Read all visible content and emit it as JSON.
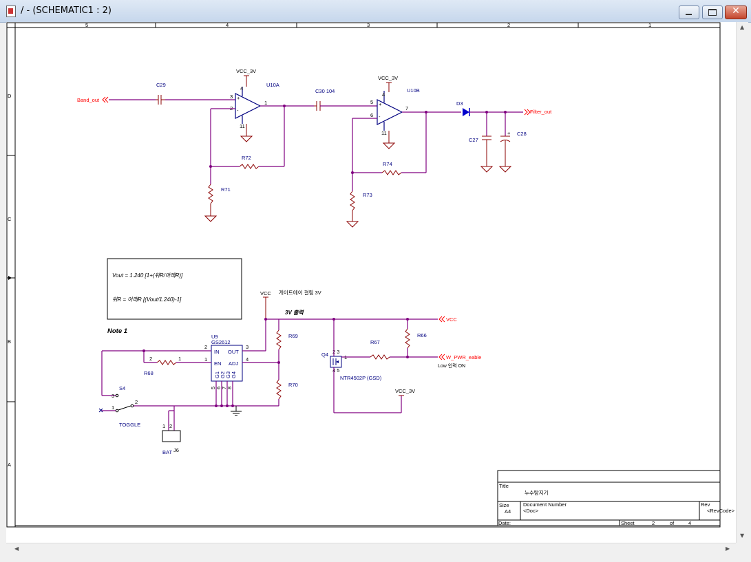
{
  "window": {
    "title": "/ - (SCHEMATIC1 : 2)"
  },
  "border": {
    "columns": [
      "5",
      "4",
      "3",
      "2",
      "1"
    ],
    "rows": [
      "D",
      "C",
      "B",
      "A"
    ]
  },
  "parts": {
    "C29": "C29",
    "U10A": "U10A",
    "C30": "C30  104",
    "U10B": "U10B",
    "D3": "D3",
    "C27": "C27",
    "C28": "C28",
    "R72": "R72",
    "R71": "R71",
    "R74": "R74",
    "R73": "R73",
    "U9": "U9",
    "U9_part": "GS2612",
    "R68": "R68",
    "R69": "R69",
    "R70": "R70",
    "R67": "R67",
    "R66": "R66",
    "Q4": "Q4",
    "Q4_part": "NTR4502P (GSD)",
    "S4": "S4",
    "S4_type": "TOGGLE",
    "J6": "J6",
    "J6_name": "BAT"
  },
  "pins": {
    "u10a_3": "3",
    "u10a_2": "2",
    "u10a_1": "1",
    "u10a_4": "4",
    "u10a_11": "11",
    "u10b_5": "5",
    "u10b_6": "6",
    "u10b_7": "7",
    "u10b_4": "4",
    "u10b_11": "11",
    "u9_in": "IN",
    "u9_out": "OUT",
    "u9_en": "EN",
    "u9_adj": "ADJ",
    "u9_g1": "G1",
    "u9_g2": "G2",
    "u9_g3": "G3",
    "u9_g4": "G4",
    "u9_p2": "2",
    "u9_p1": "1",
    "u9_p3": "3",
    "u9_p4": "4",
    "u9_p5": "5",
    "u9_p6": "6",
    "u9_p7": "7",
    "u9_p8": "8",
    "r68_2": "2",
    "r68_1": "1",
    "q4_d": "2 3",
    "q4_g": "1",
    "q4_s": "4 5",
    "s4_3": "3",
    "s4_1": "1",
    "s4_2": "2",
    "j6_1": "1",
    "j6_2": "2"
  },
  "nets": {
    "band_out": "Band_out",
    "filter_out": "Filter_out",
    "vcc3v_1": "VCC_3V",
    "vcc3v_2": "VCC_3V",
    "vcc3v_3": "VCC_3V",
    "vcc_1": "VCC",
    "vcc_2": "VCC",
    "w_pwr": "W_PWR_eable",
    "plus": "+"
  },
  "notes": {
    "formula1": "Vout = 1.240 [1+(위R/아래R)]",
    "formula2": "위R = 아래R [(Vout/1.240)-1]",
    "note1": "Note 1",
    "gate_voltage": "게이트에이 걸림 3V",
    "out_3v": "3V 출력",
    "low_on": "Low 인력 ON"
  },
  "titleblock": {
    "title_label": "Title",
    "title_value": "누수탐지기",
    "size_label": "Size",
    "size_value": "A4",
    "docnum_label": "Document Number",
    "docnum_value": "<Doc>",
    "rev_label": "Rev",
    "rev_value": "<RevCode>",
    "date_label": "Date:",
    "sheet_label": "Sheet",
    "sheet_value": "2",
    "of_label": "of",
    "of_value": "4"
  },
  "colors": {
    "wire": "#800080",
    "component": "#8b0000",
    "net_label": "#ff0000",
    "label": "#000080"
  }
}
